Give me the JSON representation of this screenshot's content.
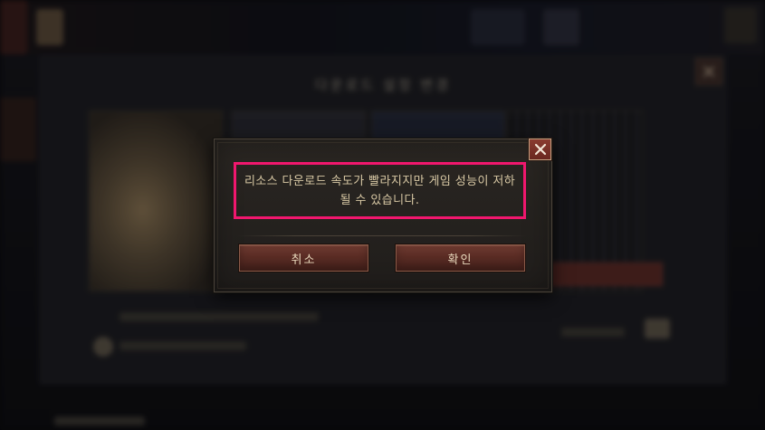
{
  "dialog": {
    "message": "리소스 다운로드 속도가 빨라지지만 게임 성능이 저하될 수 있습니다.",
    "cancel_label": "취소",
    "confirm_label": "확인",
    "close_icon": "close-icon",
    "highlight_color": "#f0176e"
  },
  "background": {
    "panel_title": "다운로드 설정 변경"
  },
  "colors": {
    "button_red": "#5a2c24",
    "text_gold": "#d8c8a4",
    "dialog_bg": "#24211e"
  }
}
